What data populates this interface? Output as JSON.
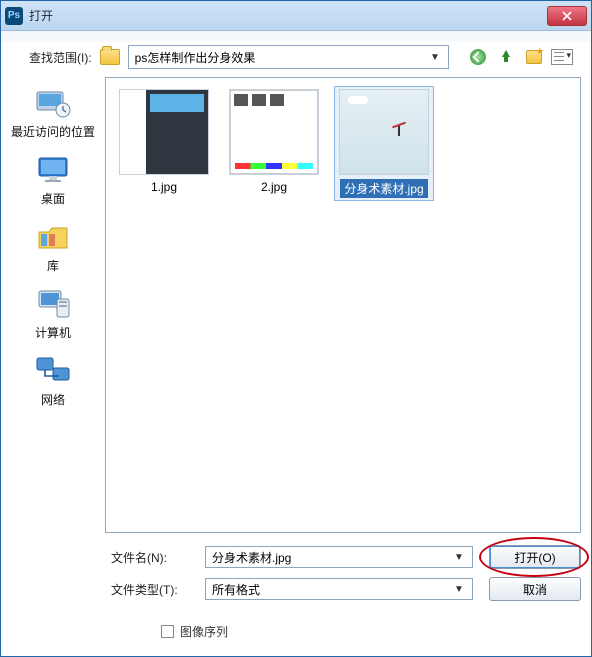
{
  "title": "打开",
  "lookin": {
    "label": "查找范围(I):",
    "folder": "ps怎样制作出分身效果"
  },
  "toolbar_icons": {
    "back": "back-icon",
    "up": "up-one-level-icon",
    "new_folder": "new-folder-icon",
    "view_menu": "view-menu-icon"
  },
  "places": [
    {
      "label": "最近访问的位置",
      "icon": "recent"
    },
    {
      "label": "桌面",
      "icon": "desktop"
    },
    {
      "label": "库",
      "icon": "libraries"
    },
    {
      "label": "计算机",
      "icon": "computer"
    },
    {
      "label": "网络",
      "icon": "network"
    }
  ],
  "files": [
    {
      "name": "1.jpg",
      "selected": false
    },
    {
      "name": "2.jpg",
      "selected": false
    },
    {
      "name": "分身术素材.jpg",
      "selected": true
    }
  ],
  "filename": {
    "label": "文件名(N):",
    "value": "分身术素材.jpg"
  },
  "filetype": {
    "label": "文件类型(T):",
    "value": "所有格式"
  },
  "buttons": {
    "open": "打开(O)",
    "cancel": "取消"
  },
  "sequence_checkbox": "图像序列"
}
